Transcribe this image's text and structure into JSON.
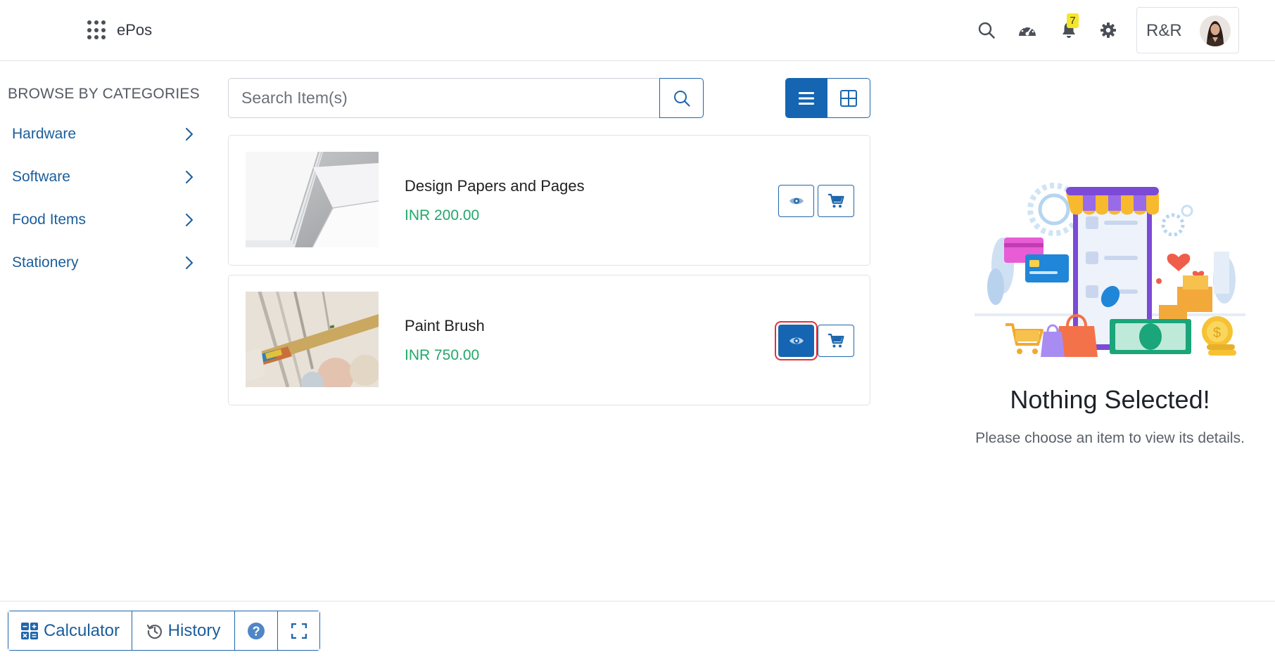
{
  "header": {
    "app_name": "ePos",
    "notification_count": "7",
    "user_name": "R&R"
  },
  "sidebar": {
    "heading": "BROWSE BY CATEGORIES",
    "categories": [
      {
        "label": "Hardware"
      },
      {
        "label": "Software"
      },
      {
        "label": "Food Items"
      },
      {
        "label": "Stationery"
      }
    ]
  },
  "search": {
    "placeholder": "Search Item(s)",
    "value": ""
  },
  "products": [
    {
      "name": "Design Papers and Pages",
      "price": "INR 200.00"
    },
    {
      "name": "Paint Brush",
      "price": "INR 750.00"
    }
  ],
  "detail": {
    "title": "Nothing Selected!",
    "subtitle": "Please choose an item to view its details."
  },
  "footer": {
    "calculator_label": "Calculator",
    "history_label": "History"
  },
  "colors": {
    "primary": "#1565b3",
    "price": "#22a86a",
    "badge": "#f5e62a",
    "focus_outline": "#e0323b"
  },
  "icons": [
    "apps-grid-icon",
    "search-icon",
    "dashboard-icon",
    "bell-icon",
    "gear-icon",
    "chevron-right-icon",
    "list-view-icon",
    "grid-view-icon",
    "eye-icon",
    "cart-icon",
    "calculator-icon",
    "history-icon",
    "help-icon",
    "fullscreen-icon"
  ]
}
